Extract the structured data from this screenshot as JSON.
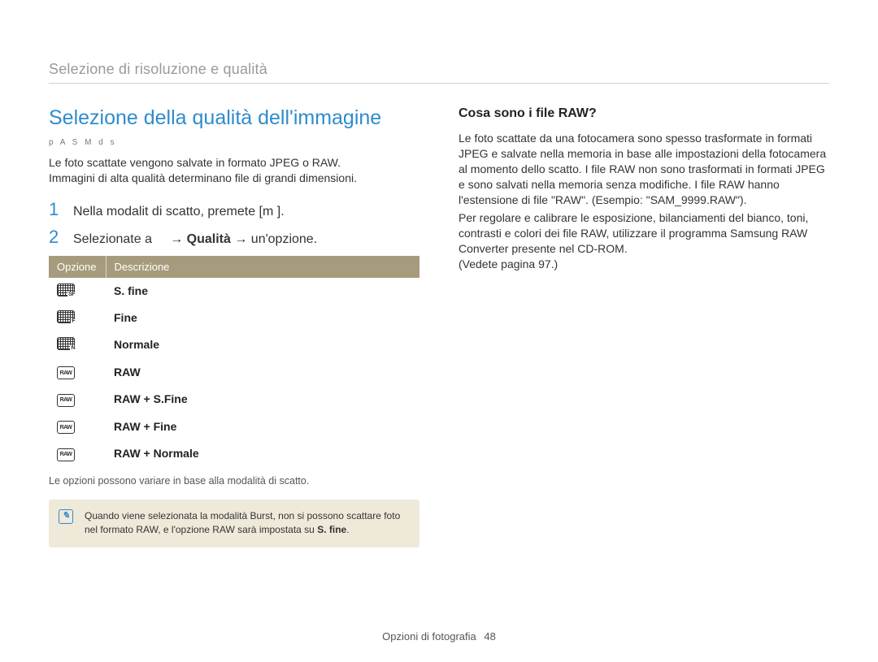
{
  "running_head": "Selezione di risoluzione e qualità",
  "left": {
    "heading": "Selezione della qualità dell'immagine",
    "modes": "p A S M d s",
    "intro_line1": "Le foto scattate vengono salvate in formato JPEG o RAW.",
    "intro_line2": "Immagini di alta qualità determinano file di grandi dimensioni.",
    "step1_num": "1",
    "step1_text_a": "Nella modalit   di scatto, premete [m",
    "step1_text_b": "].",
    "step2_num": "2",
    "step2_text_a": "Selezionate a",
    "step2_arrow1": "→",
    "step2_bold": "Qualità",
    "step2_arrow2": "→",
    "step2_text_b": "un'opzione.",
    "table_header_opt": "Opzione",
    "table_header_desc": "Descrizione",
    "rows": [
      {
        "icon": "SF",
        "icon_style": "solid",
        "label": "S. fine"
      },
      {
        "icon": "F",
        "icon_style": "solid",
        "label": "Fine"
      },
      {
        "icon": "N",
        "icon_style": "solid",
        "label": "Normale"
      },
      {
        "icon": "RAW",
        "icon_style": "line",
        "label": "RAW"
      },
      {
        "icon": "RAW",
        "icon_style": "line",
        "label": "RAW + S.Fine"
      },
      {
        "icon": "RAW",
        "icon_style": "line",
        "label": "RAW + Fine"
      },
      {
        "icon": "RAW",
        "icon_style": "line",
        "label": "RAW + Normale"
      }
    ],
    "table_note": "Le opzioni possono variare in base alla modalità di scatto.",
    "callout_a": "Quando viene selezionata la modalità Burst, non si possono scattare foto nel formato RAW, e l'opzione RAW sarà impostata su ",
    "callout_bold": "S. fine",
    "callout_b": "."
  },
  "right": {
    "heading": "Cosa sono i file RAW?",
    "para1": "Le foto scattate da una fotocamera sono spesso trasformate in formati JPEG e salvate nella memoria in base alle impostazioni della fotocamera al momento dello scatto. I file RAW non sono trasformati in formati JPEG e sono salvati nella memoria senza modifiche. I file RAW hanno l'estensione di file \"RAW\". (Esempio: \"SAM_9999.RAW\").",
    "para2": "Per regolare e calibrare le esposizione, bilanciamenti del bianco, toni, contrasti e colori dei file RAW, utilizzare il programma Samsung RAW Converter presente nel CD-ROM.",
    "para3": "(Vedete pagina 97.)"
  },
  "footer_section": "Opzioni di fotografia",
  "footer_page": "48"
}
